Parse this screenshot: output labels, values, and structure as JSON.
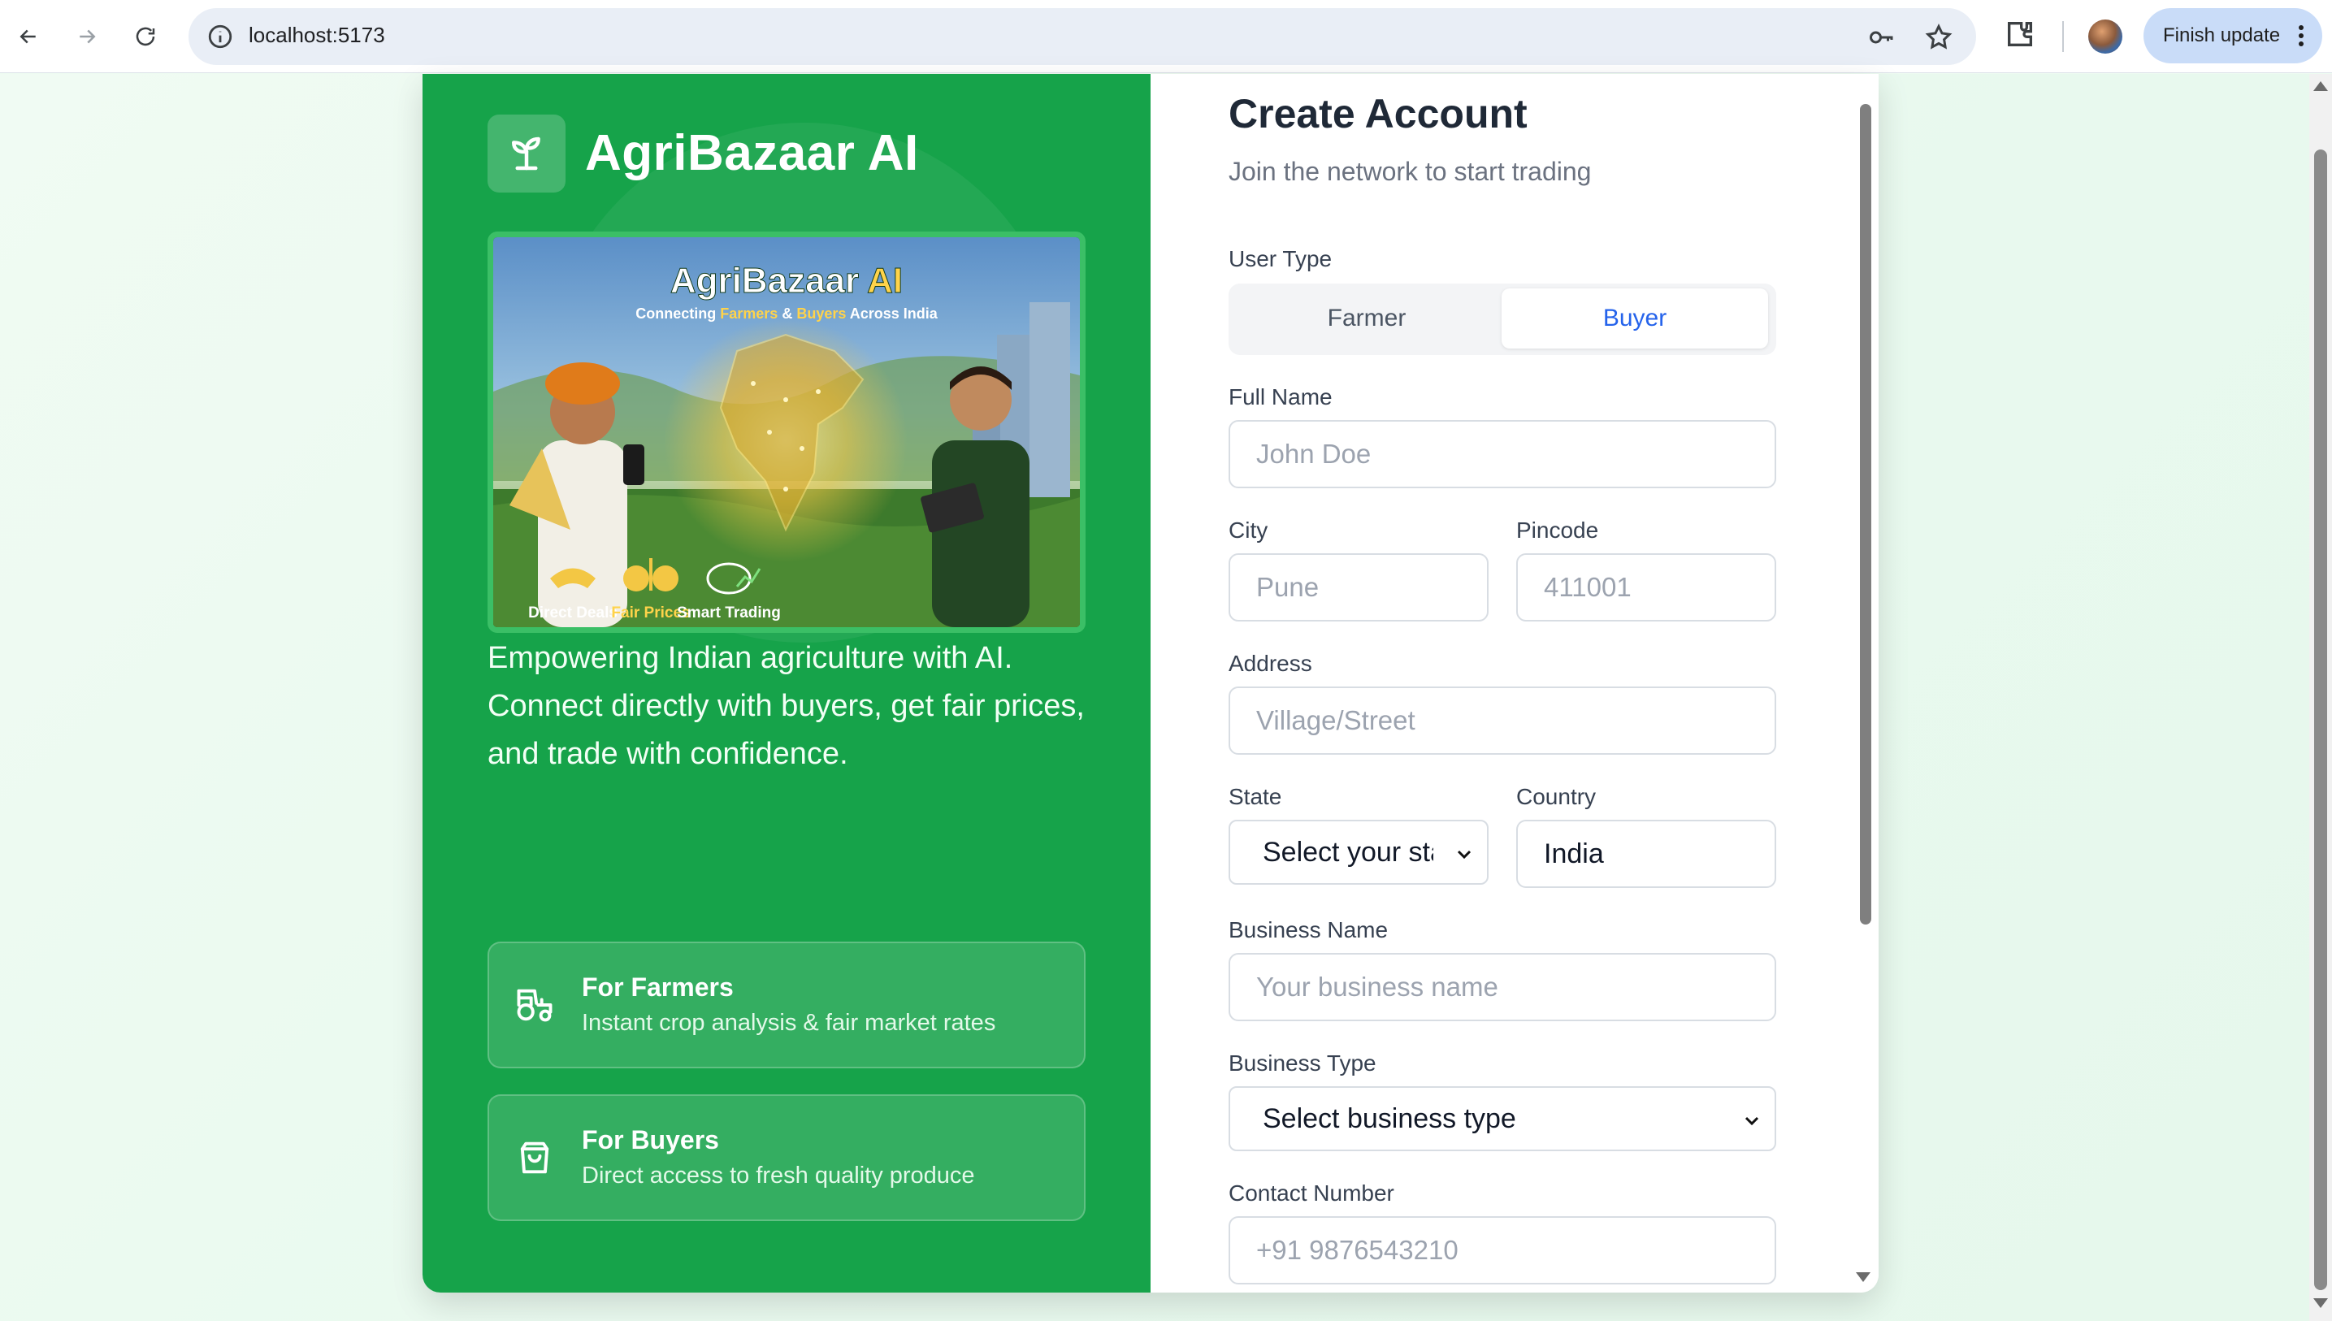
{
  "browser": {
    "url": "localhost:5173",
    "update_label": "Finish update",
    "icons": [
      "back-icon",
      "forward-icon",
      "reload-icon",
      "site-info-icon",
      "password-key-icon",
      "bookmark-star-icon",
      "extensions-icon",
      "profile-avatar",
      "more-vert-icon"
    ]
  },
  "brand": {
    "name": "AgriBazaar AI",
    "logo_icon": "sprout-icon",
    "primary_color": "#16a34a"
  },
  "hero": {
    "title_main": "AgriBazaar",
    "title_accent": "AI",
    "subtitle_pre": "Connecting ",
    "subtitle_farmers": "Farmers",
    "subtitle_mid": " & ",
    "subtitle_buyers": "Buyers",
    "subtitle_post": " Across India",
    "badges": [
      "Direct Deals",
      "Fair Prices",
      "Smart Trading"
    ]
  },
  "tagline": "Empowering Indian agriculture with AI. Connect directly with buyers, get fair prices, and trade with confidence.",
  "features": [
    {
      "title": "For Farmers",
      "desc": "Instant crop analysis & fair market rates",
      "icon": "tractor-icon"
    },
    {
      "title": "For Buyers",
      "desc": "Direct access to fresh quality produce",
      "icon": "shopping-bag-icon"
    }
  ],
  "form": {
    "title": "Create Account",
    "subtitle": "Join the network to start trading",
    "user_type": {
      "label": "User Type",
      "options": [
        "Farmer",
        "Buyer"
      ],
      "selected": "Buyer",
      "accent_color": "#2563eb"
    },
    "full_name": {
      "label": "Full Name",
      "placeholder": "John Doe"
    },
    "city": {
      "label": "City",
      "placeholder": "Pune"
    },
    "pincode": {
      "label": "Pincode",
      "placeholder": "411001"
    },
    "address": {
      "label": "Address",
      "placeholder": "Village/Street"
    },
    "state": {
      "label": "State",
      "selected": "Select your state"
    },
    "country": {
      "label": "Country",
      "value": "India"
    },
    "business_name": {
      "label": "Business Name",
      "placeholder": "Your business name"
    },
    "business_type": {
      "label": "Business Type",
      "selected": "Select business type"
    },
    "contact_number": {
      "label": "Contact Number",
      "placeholder": "+91 9876543210"
    }
  }
}
